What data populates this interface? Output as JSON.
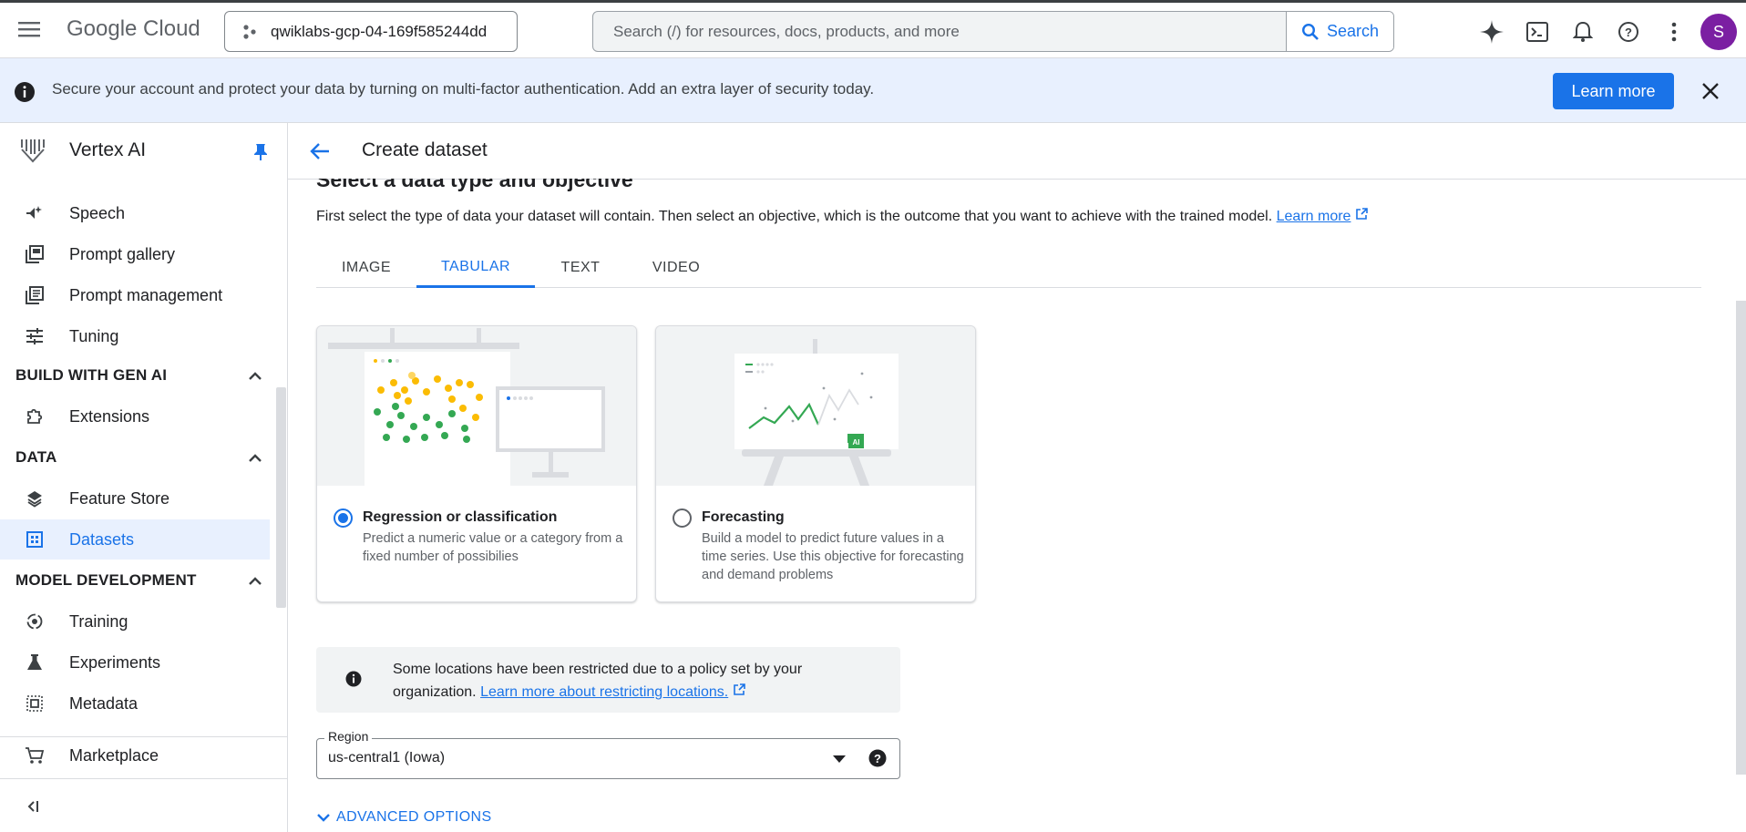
{
  "topbar": {
    "logo_text": "Google Cloud",
    "project": "qwiklabs-gcp-04-169f585244dd",
    "search_placeholder": "Search (/) for resources, docs, products, and more",
    "search_button": "Search",
    "avatar_initial": "S"
  },
  "banner": {
    "message": "Secure your account and protect your data by turning on multi-factor authentication. Add an extra layer of security today.",
    "learn_more": "Learn more"
  },
  "sidebar": {
    "product": "Vertex AI",
    "items_top": [
      {
        "label": "Speech",
        "icon": "speech-icon"
      },
      {
        "label": "Prompt gallery",
        "icon": "gallery-icon"
      },
      {
        "label": "Prompt management",
        "icon": "prompt-management-icon"
      },
      {
        "label": "Tuning",
        "icon": "tuning-icon"
      }
    ],
    "sections": {
      "build": "BUILD WITH GEN AI",
      "data": "DATA",
      "model_dev": "MODEL DEVELOPMENT"
    },
    "build_items": [
      {
        "label": "Extensions"
      }
    ],
    "data_items": [
      {
        "label": "Feature Store"
      },
      {
        "label": "Datasets"
      }
    ],
    "model_items": [
      {
        "label": "Training"
      },
      {
        "label": "Experiments"
      },
      {
        "label": "Metadata"
      }
    ],
    "marketplace": "Marketplace"
  },
  "page": {
    "title": "Create dataset",
    "section_heading": "Select a data type and objective",
    "intro": "First select the type of data your dataset will contain. Then select an objective, which is the outcome that you want to achieve with the trained model.",
    "intro_link": "Learn more"
  },
  "tabs": [
    "IMAGE",
    "TABULAR",
    "TEXT",
    "VIDEO"
  ],
  "active_tab": "TABULAR",
  "cards": [
    {
      "title": "Regression or classification",
      "desc": "Predict a numeric value or a category from a fixed number of possibilies",
      "selected": true
    },
    {
      "title": "Forecasting",
      "desc": "Build a model to predict future values in a time series. Use this objective for forecasting and demand problems",
      "selected": false
    }
  ],
  "forecast_badge": "AI",
  "info": {
    "text": "Some locations have been restricted due to a policy set by your organization.",
    "link": "Learn more about restricting locations."
  },
  "region": {
    "label": "Region",
    "value": "us-central1 (Iowa)"
  },
  "advanced": "ADVANCED OPTIONS",
  "colors": {
    "accent": "#1a73e8",
    "avatar": "#7b1fa2",
    "banner_bg": "#e8f0fe"
  }
}
